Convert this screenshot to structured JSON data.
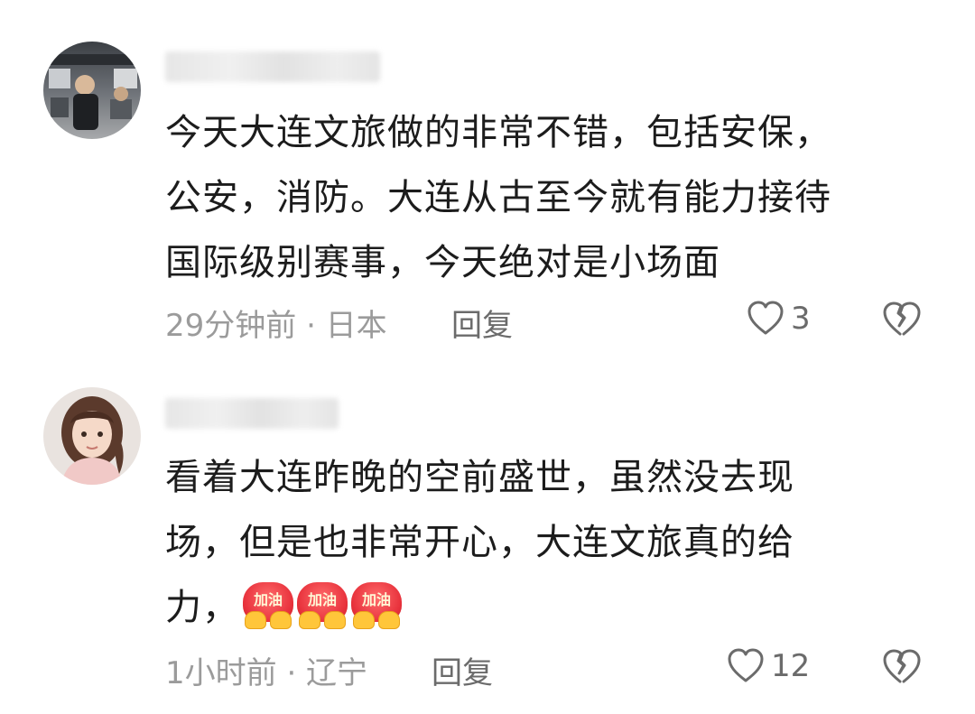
{
  "comments": [
    {
      "username": "",
      "lines": [
        "今天大连文旅做的非常不错，包括安保，",
        "公安，消防。大连从古至今就有能力接待",
        "国际级别赛事，今天绝对是小场面"
      ],
      "meta": "29分钟前 · 日本",
      "reply_label": "回复",
      "likes": "3",
      "avatar": "avatar-photo-man-on-bus"
    },
    {
      "username": "",
      "lines": [
        "看着大连昨晚的空前盛世，虽然没去现",
        "场，但是也非常开心，大连文旅真的给",
        "力，"
      ],
      "emoji_label": "加油",
      "emoji_count": 3,
      "meta": "1小时前 · 辽宁",
      "reply_label": "回复",
      "likes": "12",
      "avatar": "avatar-illustrated-girl"
    }
  ],
  "icons": {
    "like": "heart-outline-icon",
    "dislike": "broken-heart-icon"
  },
  "colors": {
    "text": "#1c1c1c",
    "meta": "#9b9b9b",
    "action": "#6b6b6b",
    "emoji_red": "#e8323c",
    "emoji_hands": "#ffc63a"
  }
}
